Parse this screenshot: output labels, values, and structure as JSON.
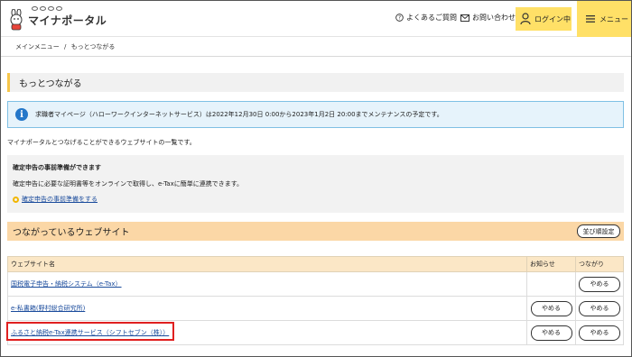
{
  "header": {
    "logo_text": "マイナポータル",
    "faq_label": "よくあるご質問",
    "contact_label": "お問い合わせ",
    "login_label": "ログイン中",
    "menu_label": "メニュー"
  },
  "breadcrumb": {
    "home": "メインメニュー",
    "separator": "/",
    "current": "もっとつながる"
  },
  "page_title": "もっとつながる",
  "notice": {
    "icon": "info-icon",
    "text": "求職者マイページ（ハローワークインターネットサービス）は2022年12月30日 0:00から2023年1月2日 20:00までメンテナンスの予定です。"
  },
  "intro_text": "マイナポータルとつなげることができるウェブサイトの一覧です。",
  "tax_prep": {
    "title": "確定申告の事前準備ができます",
    "description": "確定申告に必要な証明書等をオンラインで取得し、e-Taxに簡単に連携できます。",
    "link": "確定申告の事前準備をする"
  },
  "connected": {
    "title": "つながっているウェブサイト",
    "reorder_label": "並び順設定",
    "columns": {
      "site": "ウェブサイト名",
      "notice": "お知らせ",
      "connection": "つながり"
    },
    "rows": [
      {
        "name": "国税電子申告・納税システム（e-Tax）",
        "notice_button": "",
        "stop_button": "やめる"
      },
      {
        "name": "e-私書箱(野村総合研究所)",
        "notice_button": "やめる",
        "stop_button": "やめる"
      },
      {
        "name": "ふるさと納税e-Tax連携サービス（シフトセブン（株））",
        "notice_button": "やめる",
        "stop_button": "やめる"
      }
    ]
  },
  "colors": {
    "accent_yellow": "#ffe067",
    "table_header": "#fbe7c6",
    "section_header": "#fbd7a6",
    "notice_bg": "#e6f3fb",
    "highlight_red": "#e02020"
  }
}
